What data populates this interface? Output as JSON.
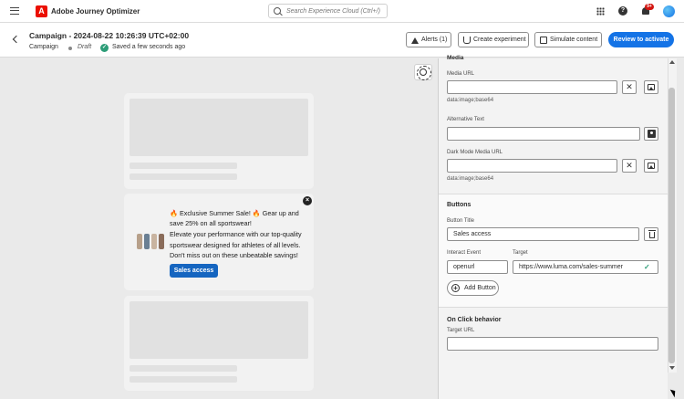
{
  "topbar": {
    "app_name": "Adobe Journey Optimizer",
    "search_placeholder": "Search Experience Cloud (Ctrl+/)",
    "notifications_badge": "9+"
  },
  "header": {
    "title": "Campaign - 2024-08-22 10:26:39 UTC+02:00",
    "breadcrumb": "Campaign",
    "status": "Draft",
    "saved_text": "Saved a few seconds ago",
    "alerts_label": "Alerts (1)",
    "experiment_label": "Create experiment",
    "simulate_label": "Simulate content",
    "review_label": "Review to activate"
  },
  "message": {
    "title": "🔥 Exclusive Summer Sale! 🔥 Gear up and save 25% on all sportswear!",
    "body": "Elevate your performance with our top-quality sportswear designed for athletes of all levels. Don't miss out on these unbeatable savings!",
    "button_label": "Sales access"
  },
  "panel": {
    "top_section_cut": "Media",
    "media_url_label": "Media URL",
    "media_url_value": "",
    "media_url_help": "data:image;base64",
    "alt_text_label": "Alternative Text",
    "alt_text_value": "",
    "dark_media_label": "Dark Mode Media URL",
    "dark_media_value": "",
    "dark_media_help": "data:image;base64",
    "buttons_title": "Buttons",
    "button_title_label": "Button Title",
    "button_title_value": "Sales access",
    "interact_event_label": "Interact Event",
    "interact_event_value": "openurl",
    "target_label": "Target",
    "target_value": "https://www.luma.com/sales-summer",
    "add_button_label": "Add Button",
    "on_click_title": "On Click behavior",
    "target_url_label": "Target URL",
    "target_url_value": ""
  },
  "colors": {
    "accent": "#1473e6",
    "brand_red": "#eb1000",
    "success": "#2d9d78",
    "message_button": "#1565c0"
  },
  "icons": {
    "menu": "hamburger-icon",
    "search": "search-icon",
    "apps": "apps-grid-icon",
    "help": "help-icon",
    "notifications": "bell-icon",
    "theme": "sun-icon",
    "close": "close-icon",
    "clear": "clear-icon",
    "asset": "image-picker-icon",
    "delete": "trash-icon",
    "add": "plus-circle-icon",
    "valid": "checkmark-icon"
  }
}
